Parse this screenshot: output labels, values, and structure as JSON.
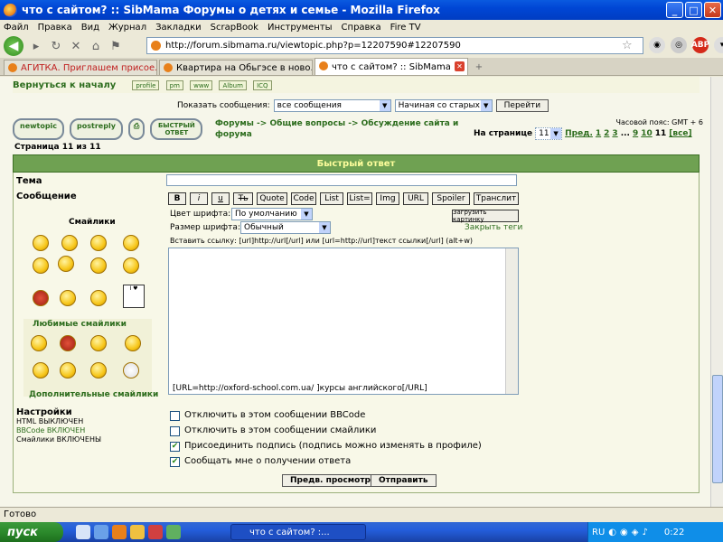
{
  "window": {
    "title": "что с сайтом? :: SibMama Форумы о детях и семье - Mozilla Firefox"
  },
  "menu": [
    "Файл",
    "Правка",
    "Вид",
    "Журнал",
    "Закладки",
    "ScrapBook",
    "Инструменты",
    "Справка",
    "Fire TV"
  ],
  "nav": {
    "url": "http://forum.sibmama.ru/viewtopic.php?p=12207590#12207590"
  },
  "tabs": [
    {
      "label": "АГИТКА. Приглашем присое...",
      "active": false
    },
    {
      "label": "Квартира на Обьгэсе в ново...",
      "active": false
    },
    {
      "label": "что с сайтом? :: SibMama ...",
      "active": true
    }
  ],
  "topbar": {
    "back_label": "Вернуться к началу",
    "buttons": [
      "profile",
      "pm",
      "www",
      "Album",
      "ICQ"
    ]
  },
  "filter": {
    "show_label": "Показать сообщения:",
    "messages_value": "все сообщения",
    "order_value": "Начиная со старых",
    "go_label": "Перейти"
  },
  "topic_buttons": {
    "newtopic": "newtopic",
    "postreply": "postreply",
    "quick": "БЫСТРЫЙ ОТВЕТ"
  },
  "breadcrumb": "Форумы -> Общие вопросы -> Обсуждение сайта и форума",
  "pagination": {
    "timezone": "Часовой пояс: GMT + 6",
    "on_page_label": "На странице",
    "current_select": "11",
    "prev": "Пред.",
    "pages": [
      "1",
      "2",
      "3",
      "...",
      "9",
      "10"
    ],
    "current": "11",
    "all": "[все]",
    "page_of": "Страница 11 из 11"
  },
  "form": {
    "header": "Быстрый ответ",
    "subject_label": "Тема",
    "message_label": "Сообщение",
    "smilies_label": "Смайлики",
    "fav_smilies_label": "Любимые смайлики",
    "more_smilies_label": "Дополнительные смайлики",
    "bbcode": [
      "B",
      "i",
      "u",
      "Ть",
      "Quote",
      "Code",
      "List",
      "List=",
      "Img",
      "URL",
      "Spoiler",
      "Транслит"
    ],
    "font_color_label": "Цвет шрифта:",
    "font_color_value": "По умолчанию",
    "font_size_label": "Размер шрифта:",
    "font_size_value": "Обычный",
    "upload_label": "Загрузить картинку",
    "close_tags": "Закрыть теги",
    "link_hint": "Вставить ссылку: [url]http://url[/url] или [url=http://url]текст ссылки[/url]  (alt+w)",
    "message_text": "[URL=http://oxford-school.com.ua/ ]курсы английского[/URL]",
    "settings_label": "Настройки",
    "settings": [
      "HTML ВЫКЛЮЧЕН",
      "BBCode ВКЛЮЧЕН",
      "Смайлики ВКЛЮЧЕНЫ"
    ],
    "options": [
      {
        "label": "Отключить в этом сообщении BBCode",
        "checked": false
      },
      {
        "label": "Отключить в этом сообщении смайлики",
        "checked": false
      },
      {
        "label": "Присоединить подпись (подпись можно изменять в профиле)",
        "checked": true
      },
      {
        "label": "Сообщать мне о получении ответа",
        "checked": true
      }
    ],
    "preview_label": "Предв. просмотр",
    "send_label": "Отправить"
  },
  "status": "Готово",
  "taskbar": {
    "start": "пуск",
    "task": "что с сайтом? :...",
    "lang": "RU",
    "time": "0:22"
  }
}
